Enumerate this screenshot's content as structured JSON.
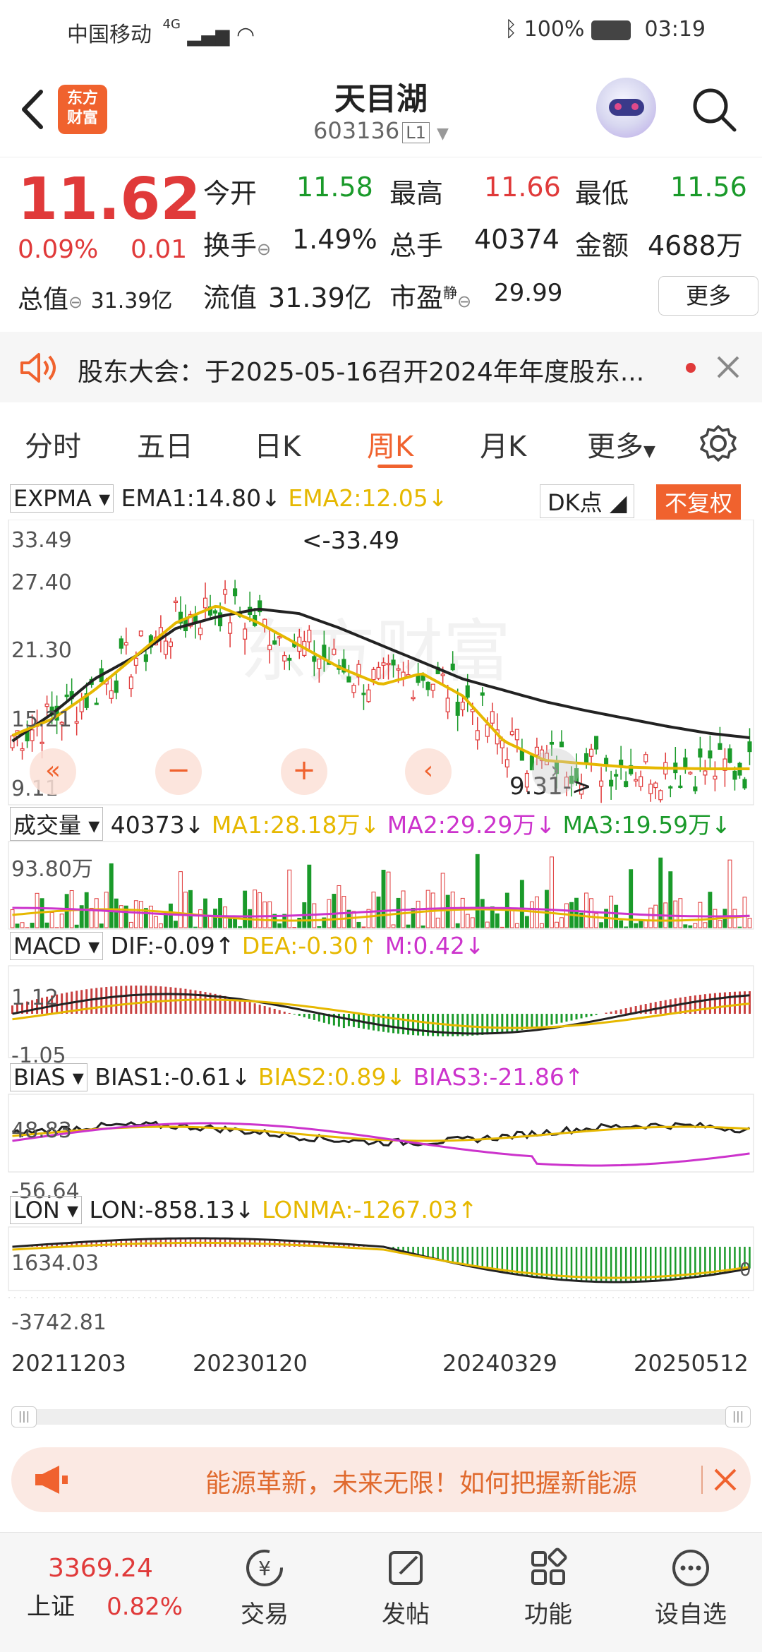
{
  "status_bar": {
    "carrier": "中国移动",
    "signal": "4G",
    "battery": "100%",
    "time": "03:19"
  },
  "header": {
    "logo_text_line1": "东方",
    "logo_text_line2": "财富",
    "stock_name": "天目湖",
    "stock_code": "603136",
    "level_tag": "L1"
  },
  "quote": {
    "price": "11.62",
    "change_pct": "0.09%",
    "change_val": "0.01",
    "total_value_label": "总值",
    "total_value": "31.39亿",
    "items": [
      {
        "label": "今开",
        "value": "11.58",
        "color": "#1a9a2a"
      },
      {
        "label": "最高",
        "value": "11.66",
        "color": "#e03a3a"
      },
      {
        "label": "最低",
        "value": "11.56",
        "color": "#1a9a2a"
      },
      {
        "label": "换手",
        "value": "1.49%",
        "color": "#222222"
      },
      {
        "label": "总手",
        "value": "40374",
        "color": "#222222"
      },
      {
        "label": "金额",
        "value": "4688万",
        "color": "#222222"
      },
      {
        "label": "流值",
        "value": "31.39亿",
        "color": "#222222"
      },
      {
        "label": "市盈",
        "value": "29.99",
        "color": "#222222"
      }
    ],
    "pe_superscript": "静",
    "more_button": "更多"
  },
  "notice": {
    "text": "股东大会：于2025-05-16召开2024年年度股东..."
  },
  "tabs": [
    "分时",
    "五日",
    "日K",
    "周K",
    "月K",
    "更多"
  ],
  "active_tab": "周K",
  "indicators": {
    "main": {
      "name": "EXPMA",
      "ema1": "EMA1:14.80↓",
      "ema2": "EMA2:12.05↓",
      "dk": "DK点",
      "adjust": "不复权"
    },
    "volume": {
      "name": "成交量",
      "vol": "40373↓",
      "ma1": "MA1:28.18万↓",
      "ma2": "MA2:29.29万↓",
      "ma3": "MA3:19.59万↓",
      "max": "93.80万"
    },
    "macd": {
      "name": "MACD",
      "dif": "DIF:-0.09↑",
      "dea": "DEA:-0.30↑",
      "m": "M:0.42↓",
      "max": "1.12",
      "min": "-1.05"
    },
    "bias": {
      "name": "BIAS",
      "b1": "BIAS1:-0.61↓",
      "b2": "BIAS2:0.89↓",
      "b3": "BIAS3:-21.86↑",
      "max": "48.83",
      "min": "-56.64"
    },
    "lon": {
      "name": "LON",
      "lon": "LON:-858.13↓",
      "lonma": "LONMA:-1267.03↑",
      "max": "1634.03",
      "min": "-3742.81",
      "right": "0"
    }
  },
  "price_axis": [
    "33.49",
    "27.40",
    "21.30",
    "15.21",
    "9.11"
  ],
  "price_marks": {
    "high": "<-33.49",
    "low": "9.31->"
  },
  "dates": [
    "20211203",
    "20230120",
    "20240329",
    "20250512"
  ],
  "chart_data": {
    "type": "line",
    "ylim": [
      9.11,
      33.49
    ],
    "series": [
      {
        "name": "EMA1",
        "values": [
          14.5,
          17,
          20,
          22,
          24.5,
          25.5,
          26.2,
          25.8,
          24.5,
          23,
          21.5,
          20,
          19,
          18,
          17.2,
          16.5,
          15.8,
          15.2,
          14.8
        ]
      },
      {
        "name": "EMA2",
        "values": [
          15,
          16.5,
          19,
          22,
          25,
          26.5,
          25,
          23,
          21,
          19.5,
          20.5,
          18.5,
          14.5,
          12.8,
          12.5,
          12.2,
          12.1,
          12.05,
          12.05
        ]
      }
    ]
  },
  "ad": {
    "text": "能源革新，未来无限！如何把握新能源"
  },
  "bottom_nav": {
    "index_value": "3369.24",
    "index_name": "上证",
    "index_change": "0.82%",
    "items": [
      "交易",
      "发帖",
      "功能",
      "设自选"
    ]
  }
}
